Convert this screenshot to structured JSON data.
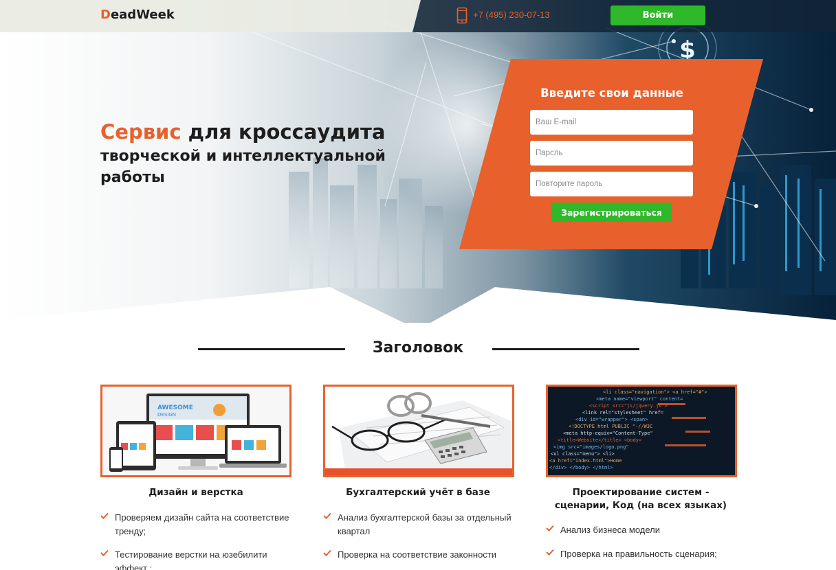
{
  "header": {
    "logo_first": "D",
    "logo_rest": "eadWeek",
    "phone": "+7 (495) 230-07-13",
    "login_label": "Войти"
  },
  "hero": {
    "title_accent": "Сервис",
    "title_rest": " для кроссаудита",
    "subtitle_line1": "творческой и интеллектуальной",
    "subtitle_line2": "работы"
  },
  "form": {
    "title": "Введите свои данные",
    "email_placeholder": "Ваш E-mail",
    "password_placeholder": "Парсль",
    "repeat_placeholder": "Повторите пароль",
    "submit_label": "Зарегистрироваться"
  },
  "section": {
    "title": "Заголовок"
  },
  "cards": [
    {
      "title": "Дизайн и верстка",
      "features": [
        "Проверяем дизайн сайта на соответствие тренду;",
        "Тестирование верстки на юзебилити эффект ;"
      ]
    },
    {
      "title": "Бухгалтерский учёт в базе",
      "features": [
        "Анализ бухгалтерской базы за отдельный квартал",
        "Проверка на соответствие законности"
      ]
    },
    {
      "title_line1": "Проектирование систем -",
      "title_line2": "сценарии, Код (на всех языках)",
      "features": [
        "Анализ бизнеса модели",
        "Проверка на правильность сценария;"
      ]
    }
  ],
  "colors": {
    "accent": "#e8612c",
    "green": "#2fb82a",
    "dark": "#1d1d1d"
  }
}
